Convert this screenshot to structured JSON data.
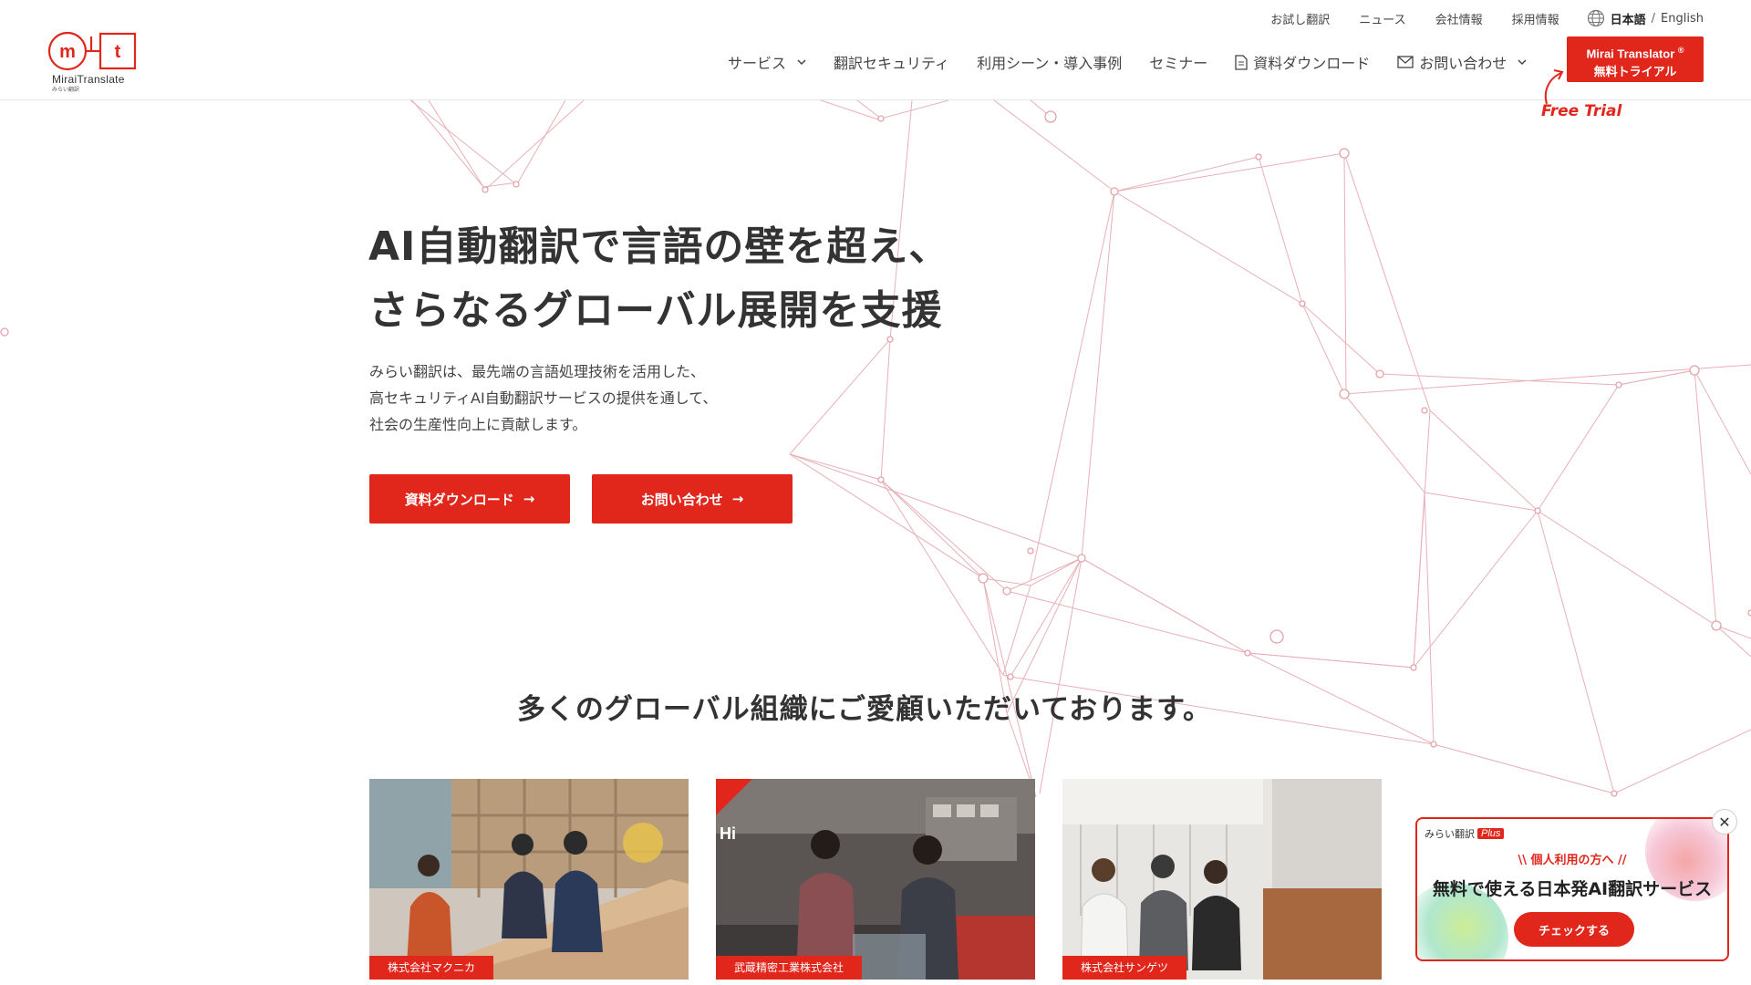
{
  "header": {
    "logo_text": "MiraiTranslate",
    "logo_sub": "みらい翻訳",
    "top_links": [
      "お試し翻訳",
      "ニュース",
      "会社情報",
      "採用情報"
    ],
    "lang_ja": "日本語",
    "lang_sep": "/",
    "lang_en": "English",
    "nav": {
      "services": "サービス",
      "security": "翻訳セキュリティ",
      "cases": "利用シーン・導入事例",
      "seminar": "セミナー",
      "download": "資料ダウンロード",
      "contact": "お問い合わせ"
    },
    "trial_line1": "Mirai Translator",
    "trial_reg": "®",
    "trial_line2": "無料トライアル",
    "free_trial": "Free Trial"
  },
  "hero": {
    "title_line1": "AI自動翻訳で言語の壁を超え、",
    "title_line2": "さらなるグローバル展開を支援",
    "desc_line1": "みらい翻訳は、最先端の言語処理技術を活用した、",
    "desc_line2": "高セキュリティAI自動翻訳サービスの提供を通して、",
    "desc_line3": "社会の生産性向上に貢献します。",
    "cta_download": "資料ダウンロード",
    "cta_contact": "お問い合わせ",
    "arrow": "→"
  },
  "clients": {
    "title": "多くのグローバル組織にご愛顧いただいております。",
    "cards": [
      {
        "company": "株式会社マクニカ"
      },
      {
        "company": "武蔵精密工業株式会社"
      },
      {
        "company": "株式会社サンゲツ"
      }
    ]
  },
  "popup": {
    "brand": "みらい翻訳",
    "plus": "Plus",
    "sub": "\\\\ 個人利用の方へ //",
    "headline": "無料で使える日本発AI翻訳サービス",
    "check": "チェックする",
    "close": "✕"
  },
  "colors": {
    "accent": "#e1261c",
    "network_line": "#e6a3a8"
  }
}
